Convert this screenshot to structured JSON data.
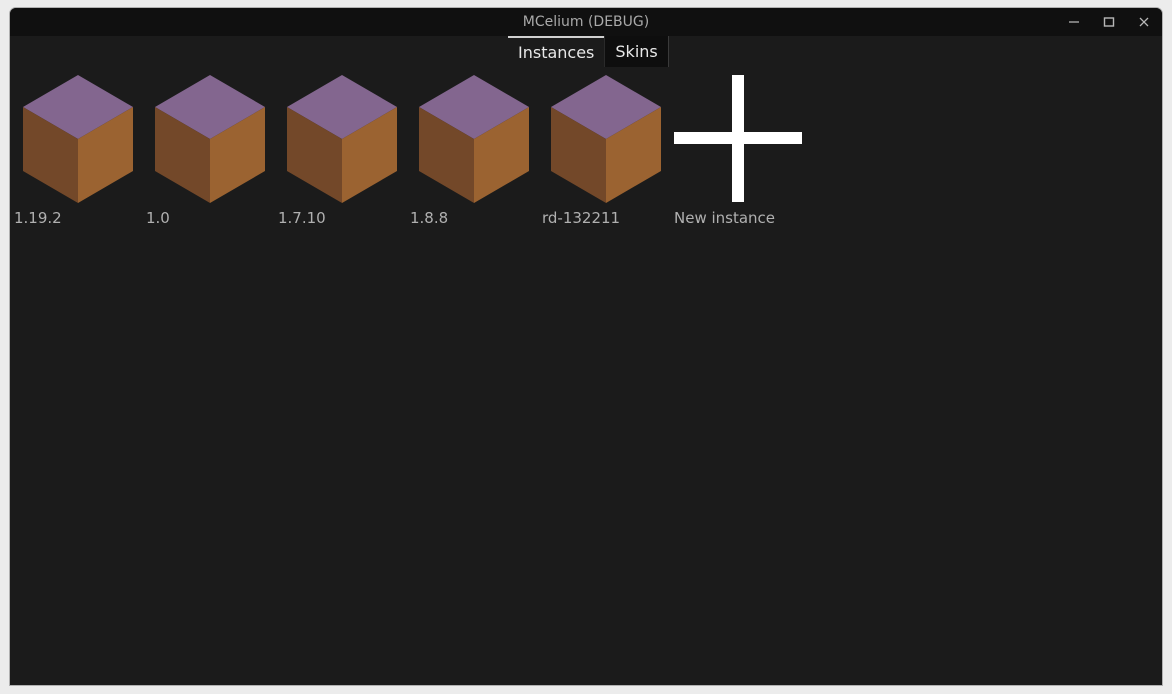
{
  "window": {
    "title": "MCelium (DEBUG)",
    "controls": [
      "minimize-icon",
      "maximize-icon",
      "close-icon"
    ]
  },
  "tabs": [
    {
      "label": "Instances",
      "active": true
    },
    {
      "label": "Skins",
      "active": false
    }
  ],
  "instances": [
    {
      "label": "1.19.2",
      "icon": "cube-icon"
    },
    {
      "label": "1.0",
      "icon": "cube-icon"
    },
    {
      "label": "1.7.10",
      "icon": "cube-icon"
    },
    {
      "label": "1.8.8",
      "icon": "cube-icon"
    },
    {
      "label": "rd-132211",
      "icon": "cube-icon"
    }
  ],
  "new_instance": {
    "label": "New instance",
    "icon": "plus-icon"
  },
  "colors": {
    "cube_top": "#83668f",
    "cube_left": "#734829",
    "cube_right": "#9b6331",
    "background": "#1b1b1b",
    "titlebar": "#101010"
  }
}
